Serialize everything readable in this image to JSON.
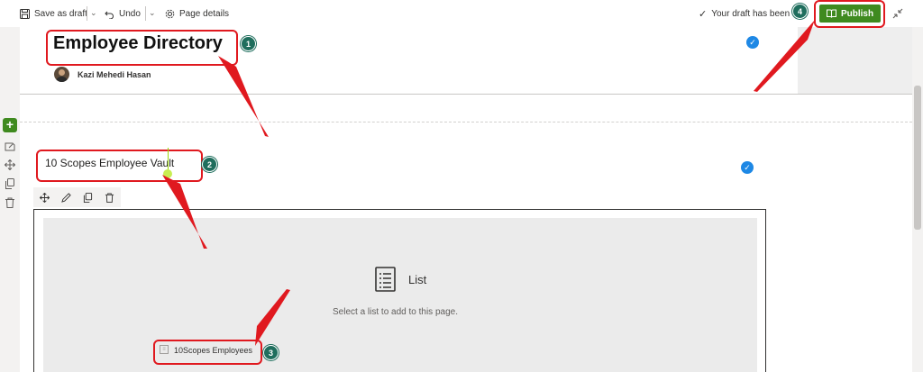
{
  "toolbar": {
    "save_draft_label": "Save as draft",
    "undo_label": "Undo",
    "page_details_label": "Page details",
    "status_text": "Your draft has been s",
    "publish_label": "Publish"
  },
  "header": {
    "title": "Employee Directory",
    "author": "Kazi Mehedi Hasan"
  },
  "section": {
    "webpart_title": "10 Scopes Employee Vault"
  },
  "list_webpart": {
    "title": "List",
    "prompt": "Select a list to add to this page.",
    "list_option": "10Scopes Employees"
  },
  "callouts": [
    "1",
    "2",
    "3",
    "4"
  ],
  "colors": {
    "accent": "#1e88e5",
    "publish": "#3f8a1f",
    "callout_border": "#e0191f",
    "badge": "#1f6e5d"
  },
  "icons": [
    "save-icon",
    "undo-icon",
    "gear-icon",
    "check-icon",
    "book-icon",
    "collapse-icon",
    "plus-icon",
    "edit-icon",
    "move-icon",
    "copy-icon",
    "delete-icon",
    "list-icon"
  ]
}
